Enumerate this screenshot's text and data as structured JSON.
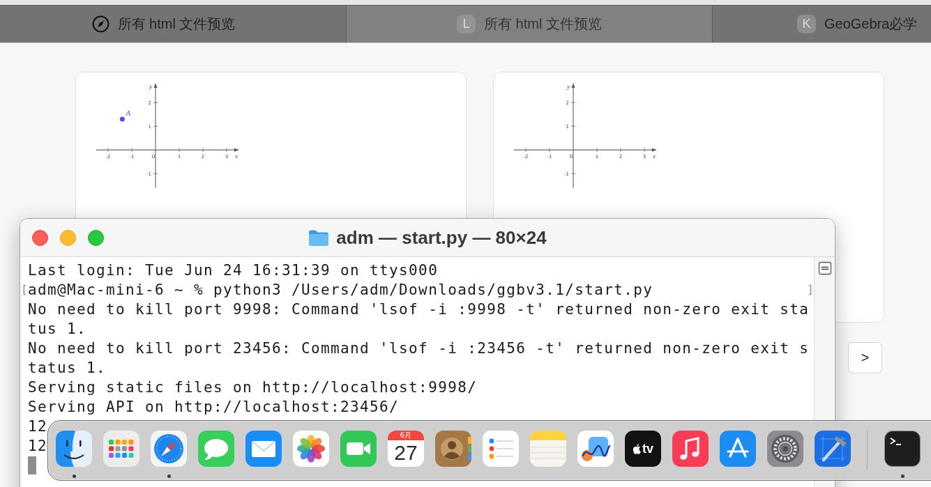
{
  "browser": {
    "tabs": [
      {
        "title": "所有 html 文件预览",
        "favicon": {
          "kind": "compass"
        },
        "selected": false
      },
      {
        "title": "所有 html 文件预览",
        "favicon": {
          "kind": "letter",
          "letter": "L"
        },
        "selected": true
      },
      {
        "title": "GeoGebra必学",
        "favicon": {
          "kind": "letter",
          "letter": "K"
        },
        "selected": false
      }
    ]
  },
  "cards": [
    {
      "chart_data": {
        "type": "scatter",
        "xlabel": "x",
        "ylabel": "y",
        "x": [
          -1.4
        ],
        "series": [
          {
            "name": "A",
            "color": "#4b4bff",
            "values": [
              1.3
            ]
          }
        ],
        "xlim": [
          -2.5,
          3.5
        ],
        "ylim": [
          -1.6,
          2.8
        ],
        "xticks": [
          -2,
          -1,
          0,
          1,
          2,
          3
        ],
        "yticks": [
          -1,
          1,
          2
        ]
      }
    },
    {
      "chart_data": {
        "type": "scatter",
        "xlabel": "x",
        "ylabel": "y",
        "xlim": [
          -2.5,
          3.5
        ],
        "ylim": [
          -1.6,
          2.8
        ],
        "xticks": [
          -2,
          -1,
          0,
          1,
          2,
          3
        ],
        "yticks": [
          -1,
          1,
          2
        ]
      }
    }
  ],
  "pager": {
    "next_label": ">"
  },
  "terminal": {
    "title": "adm — start.py — 80×24",
    "lines": [
      {
        "text": "Last login: Tue Jun 24 16:31:39 on ttys000"
      },
      {
        "text": "adm@Mac-mini-6 ~ % python3 /Users/adm/Downloads/ggbv3.1/start.py",
        "mark_open": "[",
        "mark_close": "]"
      },
      {
        "text": "No need to kill port 9998: Command 'lsof -i :9998 -t' returned non-zero exit sta"
      },
      {
        "text": "tus 1."
      },
      {
        "text": "No need to kill port 23456: Command 'lsof -i :23456 -t' returned non-zero exit s"
      },
      {
        "text": "tatus 1."
      },
      {
        "text": "Serving static files on http://localhost:9998/"
      },
      {
        "text": "Serving API on http://localhost:23456/"
      },
      {
        "text": "12"
      },
      {
        "text": "12"
      }
    ],
    "cursor_visible": true
  },
  "dock": {
    "apps": [
      {
        "kind": "finder",
        "running": true
      },
      {
        "kind": "launchpad",
        "running": false
      },
      {
        "kind": "safari",
        "running": true
      },
      {
        "kind": "messages",
        "running": false
      },
      {
        "kind": "mail",
        "running": false
      },
      {
        "kind": "photos",
        "running": false
      },
      {
        "kind": "facetime",
        "running": false
      },
      {
        "kind": "calendar",
        "month": "6月",
        "day": "27",
        "running": false
      },
      {
        "kind": "contacts",
        "running": false
      },
      {
        "kind": "reminders",
        "running": false
      },
      {
        "kind": "notes",
        "running": false
      },
      {
        "kind": "freeform",
        "running": false
      },
      {
        "kind": "tv",
        "label": "tv",
        "running": false
      },
      {
        "kind": "music",
        "running": false
      },
      {
        "kind": "appstore",
        "running": false
      },
      {
        "kind": "settings",
        "running": false
      },
      {
        "kind": "xcode",
        "running": false
      },
      {
        "kind": "divider"
      },
      {
        "kind": "terminal",
        "running": true
      }
    ]
  }
}
